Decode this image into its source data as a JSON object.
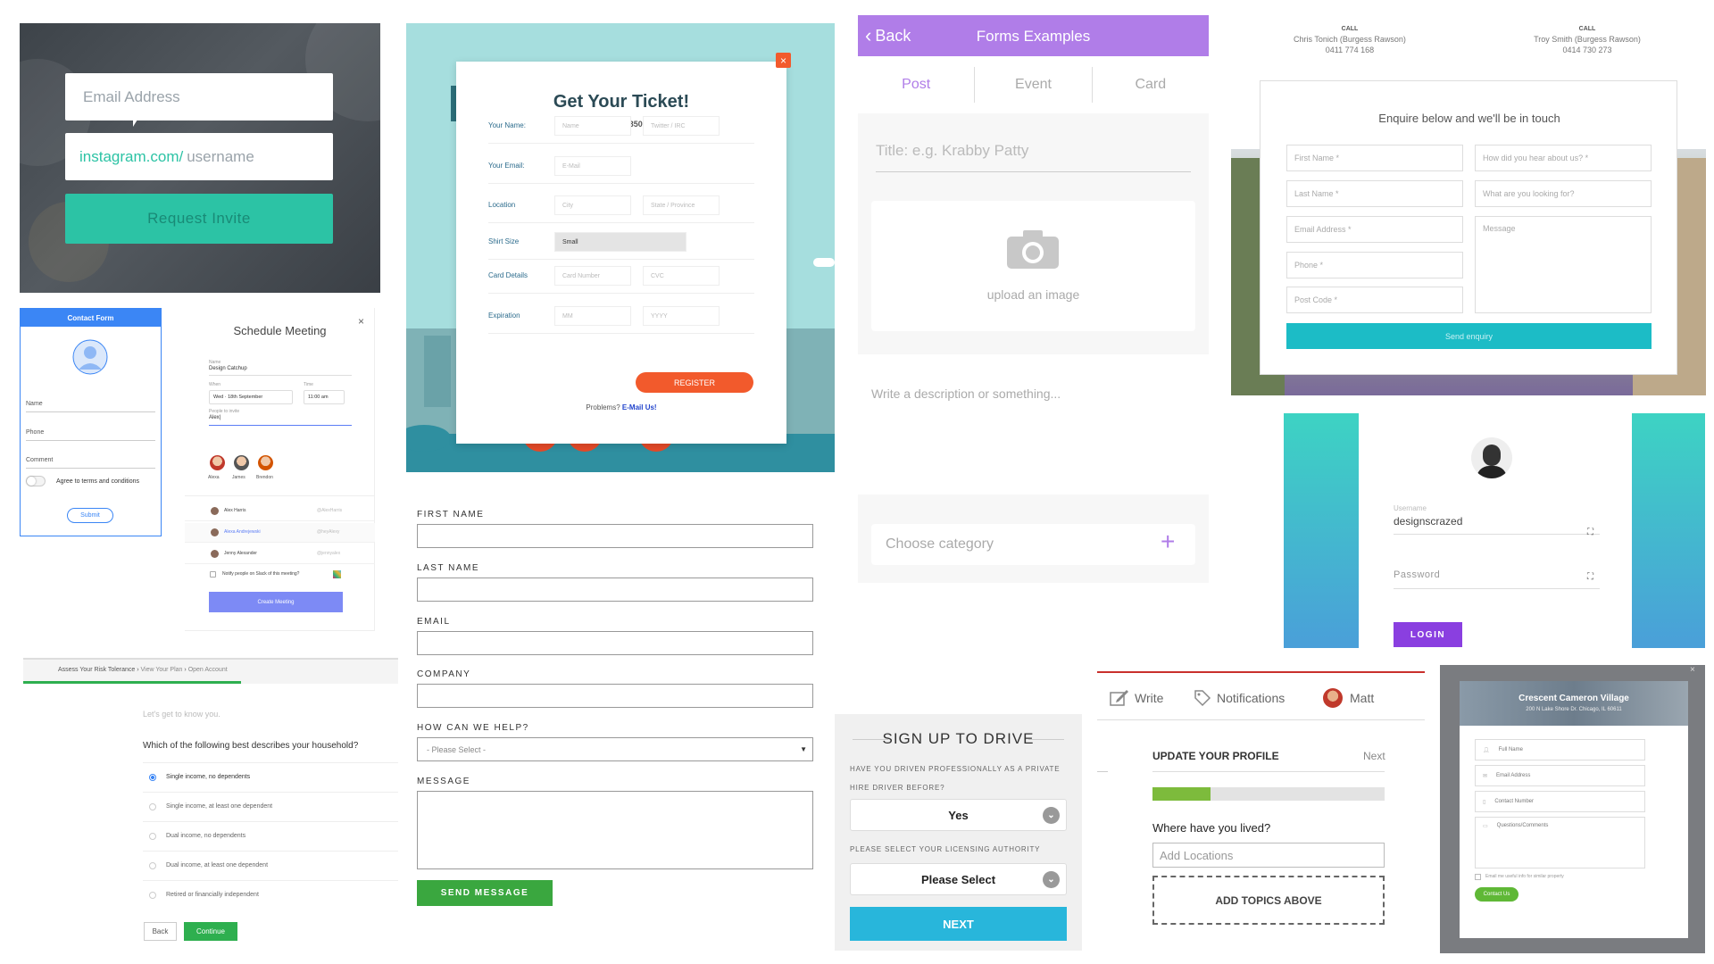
{
  "request_invite": {
    "email_placeholder": "Email Address",
    "instagram_prefix": "instagram.com/",
    "username_placeholder": "username",
    "button": "Request Invite"
  },
  "ticket": {
    "title": "Get Your Ticket!",
    "price": "Price: $350",
    "close": "×",
    "rows": [
      {
        "label": "Your Name:",
        "f1": "Name",
        "f2": "Twitter / IRC"
      },
      {
        "label": "Your Email:",
        "f1": "E-Mail",
        "f2": ""
      },
      {
        "label": "Location",
        "f1": "City",
        "f2": "State / Province"
      },
      {
        "label": "Shirt Size",
        "f1": "Small",
        "f2": ""
      },
      {
        "label": "Card Details",
        "f1": "Card Number",
        "f2": "CVC"
      },
      {
        "label": "Expiration",
        "f1": "MM",
        "f2": "YYYY"
      }
    ],
    "register": "REGISTER",
    "problems": "Problems?",
    "email_us": "E-Mail Us!"
  },
  "forms_examples": {
    "back": "Back",
    "title": "Forms Examples",
    "tabs": [
      "Post",
      "Event",
      "Card"
    ],
    "title_placeholder": "Title: e.g. Krabby Patty",
    "upload": "upload an image",
    "description_placeholder": "Write a description or something...",
    "category": "Choose category",
    "plus": "+"
  },
  "enquiry": {
    "call1_label": "CALL",
    "call1_name": "Chris Tonich (Burgess Rawson)",
    "call1_phone": "0411 774 168",
    "call2_label": "CALL",
    "call2_name": "Troy Smith (Burgess Rawson)",
    "call2_phone": "0414 730 273",
    "heading": "Enquire below and we'll be in touch",
    "first_name": "First Name *",
    "last_name": "Last Name *",
    "email": "Email Address *",
    "phone": "Phone *",
    "post_code": "Post Code *",
    "hear": "How did you hear about us? *",
    "looking": "What are you looking for?",
    "message": "Message",
    "send": "Send enquiry"
  },
  "contact_form": {
    "header": "Contact Form",
    "name": "Name",
    "phone": "Phone",
    "comment": "Comment",
    "agree": "Agree to terms and conditions",
    "submit": "Submit"
  },
  "meeting": {
    "title": "Schedule Meeting",
    "close": "×",
    "name_label": "Name",
    "name_value": "Design Catchup",
    "when_label": "When",
    "when_value": "Wed · 18th September",
    "time_label": "Time",
    "time_value": "11:00 am",
    "invite_label": "People to invite",
    "invite_value": "Alex|",
    "people": [
      "Alexa",
      "James",
      "Brendon"
    ],
    "suggestions": [
      {
        "name": "Alex Harris",
        "handle": "@AlexHarris"
      },
      {
        "name": "Alexa Andrejewski",
        "handle": "@heyAlexy"
      },
      {
        "name": "Jenny Alexander",
        "handle": "@jennyalex"
      }
    ],
    "notify": "Notify people on Slack of this meeting?",
    "create": "Create Meeting"
  },
  "risk": {
    "breadcrumb": [
      "Assess Your Risk Tolerance",
      "View Your Plan",
      "Open Account"
    ],
    "progress": 0.58,
    "intro": "Let's get to know you.",
    "question": "Which of the following best describes your household?",
    "options": [
      "Single income, no dependents",
      "Single income, at least one dependent",
      "Dual income, no dependents",
      "Dual income, at least one dependent",
      "Retired or financially independent"
    ],
    "back": "Back",
    "continue": "Continue"
  },
  "contact_long": {
    "first_name": "FIRST NAME",
    "last_name": "LAST NAME",
    "email": "EMAIL",
    "company": "COMPANY",
    "help": "HOW CAN WE HELP?",
    "help_value": "- Please Select -",
    "message": "MESSAGE",
    "send": "SEND MESSAGE"
  },
  "drive": {
    "title": "SIGN UP TO DRIVE",
    "q1": "HAVE YOU DRIVEN PROFESSIONALLY AS A PRIVATE HIRE DRIVER BEFORE?",
    "a1": "Yes",
    "q2": "PLEASE SELECT YOUR LICENSING AUTHORITY",
    "a2": "Please Select",
    "next": "NEXT"
  },
  "profile": {
    "write": "Write",
    "notifications": "Notifications",
    "user": "Matt",
    "heading": "UPDATE YOUR PROFILE",
    "next": "Next",
    "progress": 0.25,
    "question": "Where have you lived?",
    "add_placeholder": "Add Locations",
    "topics": "ADD TOPICS ABOVE"
  },
  "login": {
    "username_label": "Username",
    "username_value": "designscrazed",
    "password_label": "Password",
    "button": "LOGIN"
  },
  "village": {
    "title": "Crescent Cameron Village",
    "address": "200 N Lake Shore Dr. Chicago, IL 60611",
    "full_name": "Full Name",
    "email": "Email Address",
    "contact": "Contact Number",
    "questions": "Questions/Comments",
    "optin": "Email me useful info for similar property",
    "button": "Contact Us"
  },
  "colors": {
    "teal": "#2cc3a5",
    "purple": "#b07de8",
    "orange": "#f25a2c",
    "cyan": "#1cbcc6",
    "green": "#3aa73f",
    "blue": "#3b86f5",
    "violet": "#8a3fe0",
    "drive_blue": "#28b6db"
  }
}
